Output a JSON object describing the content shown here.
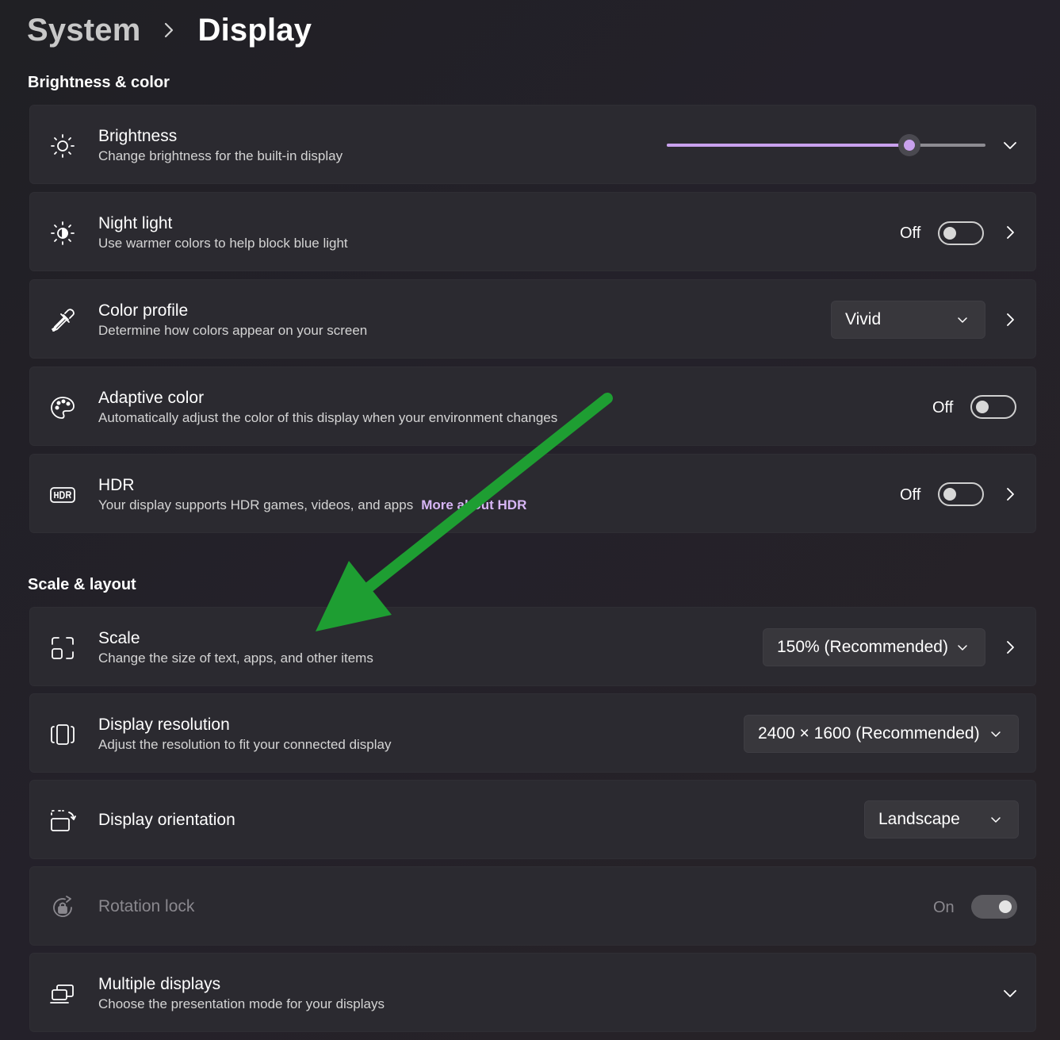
{
  "breadcrumb": {
    "parent": "System",
    "current": "Display"
  },
  "sections": {
    "brightness_color": "Brightness & color",
    "scale_layout": "Scale & layout"
  },
  "brightness": {
    "title": "Brightness",
    "desc": "Change brightness for the built-in display",
    "level_percent": 76
  },
  "night_light": {
    "title": "Night light",
    "desc": "Use warmer colors to help block blue light",
    "state": "Off"
  },
  "color_profile": {
    "title": "Color profile",
    "desc": "Determine how colors appear on your screen",
    "value": "Vivid"
  },
  "adaptive_color": {
    "title": "Adaptive color",
    "desc": "Automatically adjust the color of this display when your environment changes",
    "state": "Off"
  },
  "hdr": {
    "title": "HDR",
    "desc": "Your display supports HDR games, videos, and apps",
    "link": "More about HDR",
    "state": "Off"
  },
  "scale": {
    "title": "Scale",
    "desc": "Change the size of text, apps, and other items",
    "value": "150% (Recommended)"
  },
  "resolution": {
    "title": "Display resolution",
    "desc": "Adjust the resolution to fit your connected display",
    "value": "2400 × 1600 (Recommended)"
  },
  "orientation": {
    "title": "Display orientation",
    "value": "Landscape"
  },
  "rotation_lock": {
    "title": "Rotation lock",
    "state": "On"
  },
  "multiple_displays": {
    "title": "Multiple displays",
    "desc": "Choose the presentation mode for your displays"
  },
  "icons": {
    "brightness": "sun-icon",
    "night_light": "night-light-icon",
    "color_profile": "eyedropper-icon",
    "adaptive_color": "palette-icon",
    "hdr": "hdr-icon",
    "scale": "scale-icon",
    "resolution": "resolution-icon",
    "orientation": "orientation-icon",
    "rotation_lock": "rotation-lock-icon",
    "multiple_displays": "multiple-displays-icon"
  },
  "colors": {
    "accent": "#c9a1ee",
    "card": "#2b2a30",
    "annotation_arrow": "#1e9e32"
  }
}
